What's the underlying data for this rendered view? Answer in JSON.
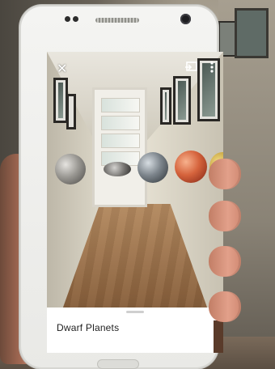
{
  "screen": {
    "top_bar": {
      "close_icon": "close-icon",
      "cast_icon": "cast-icon",
      "menu_icon": "more-vert-icon"
    },
    "planets": [
      {
        "name": "gray-moon",
        "color": "#9a9893"
      },
      {
        "name": "dark-moon",
        "color": "#7a7875"
      },
      {
        "name": "blue-gray-planet",
        "color": "#7d858c"
      },
      {
        "name": "red-planet",
        "color": "#d5633c"
      },
      {
        "name": "yellow-planet",
        "color": "#c4a23a"
      }
    ],
    "bottom_sheet": {
      "title": "Dwarf Planets"
    }
  }
}
